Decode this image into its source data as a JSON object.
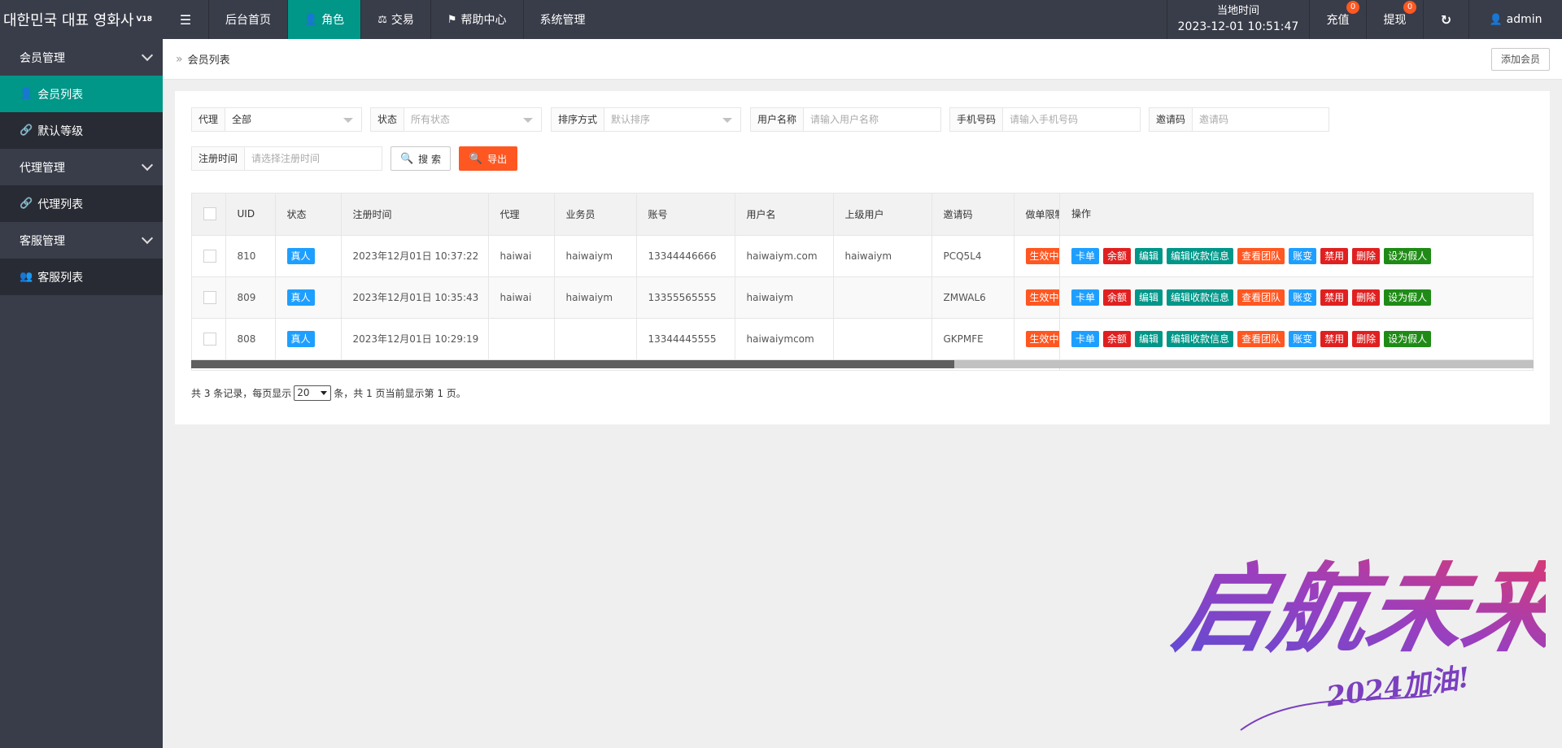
{
  "header": {
    "brand": "대한민국 대표 영화사",
    "version": "V18",
    "nav": [
      {
        "label": "后台首页",
        "icon": ""
      },
      {
        "label": "角色",
        "icon": "user-icon",
        "active": true
      },
      {
        "label": "交易",
        "icon": "scale-icon"
      },
      {
        "label": "帮助中心",
        "icon": "flag-icon"
      },
      {
        "label": "系统管理",
        "icon": ""
      }
    ],
    "clock_label": "当地时间",
    "clock_value": "2023-12-01 10:51:47",
    "recharge_label": "充值",
    "recharge_badge": "0",
    "withdraw_label": "提现",
    "withdraw_badge": "0",
    "user": "admin"
  },
  "sidebar": {
    "groups": [
      {
        "label": "会员管理",
        "items": [
          {
            "label": "会员列表",
            "active": true
          },
          {
            "label": "默认等级"
          }
        ]
      },
      {
        "label": "代理管理",
        "items": [
          {
            "label": "代理列表"
          }
        ]
      },
      {
        "label": "客服管理",
        "items": [
          {
            "label": "客服列表"
          }
        ]
      }
    ]
  },
  "breadcrumb": {
    "current": "会员列表",
    "add_button": "添加会员"
  },
  "filters": {
    "agent": {
      "label": "代理",
      "value": "全部"
    },
    "status": {
      "label": "状态",
      "placeholder": "所有状态"
    },
    "sort": {
      "label": "排序方式",
      "placeholder": "默认排序"
    },
    "username": {
      "label": "用户名称",
      "placeholder": "请输入用户名称"
    },
    "phone": {
      "label": "手机号码",
      "placeholder": "请输入手机号码"
    },
    "invite": {
      "label": "邀请码",
      "placeholder": "邀请码"
    },
    "regtime": {
      "label": "注册时间",
      "placeholder": "请选择注册时间"
    },
    "search_button": "搜 索",
    "export_button": "导出"
  },
  "table": {
    "headers": [
      "UID",
      "状态",
      "注册时间",
      "代理",
      "业务员",
      "账号",
      "用户名",
      "上级用户",
      "邀请码",
      "做单限制",
      "操作"
    ],
    "rows": [
      {
        "uid": "810",
        "status": "真人",
        "reg_time": "2023年12月01日 10:37:22",
        "agent": "haiwai",
        "salesman": "haiwaiym",
        "account": "13344446666",
        "username": "haiwaiym.com",
        "parent": "haiwaiym",
        "invite": "PCQ5L4",
        "limit": "生效中"
      },
      {
        "uid": "809",
        "status": "真人",
        "reg_time": "2023年12月01日 10:35:43",
        "agent": "haiwai",
        "salesman": "haiwaiym",
        "account": "13355565555",
        "username": "haiwaiym",
        "parent": "",
        "invite": "ZMWAL6",
        "limit": "生效中"
      },
      {
        "uid": "808",
        "status": "真人",
        "reg_time": "2023年12月01日 10:29:19",
        "agent": "",
        "salesman": "",
        "account": "13344445555",
        "username": "haiwaiymcom",
        "parent": "",
        "invite": "GKPMFE",
        "limit": "生效中"
      }
    ],
    "actions": [
      {
        "label": "卡单",
        "color": "#1e9fff"
      },
      {
        "label": "余额",
        "color": "#e02020"
      },
      {
        "label": "编辑",
        "color": "#009688"
      },
      {
        "label": "编辑收款信息",
        "color": "#009688"
      },
      {
        "label": "查看团队",
        "color": "#ff5722"
      },
      {
        "label": "账变",
        "color": "#1e9fff"
      },
      {
        "label": "禁用",
        "color": "#e02020"
      },
      {
        "label": "删除",
        "color": "#e02020"
      },
      {
        "label": "设为假人",
        "color": "#1f8b16"
      }
    ]
  },
  "pager": {
    "prefix": "共 3 条记录，每页显示",
    "page_size": "20",
    "suffix": "条，共 1 页当前显示第 1 页。"
  },
  "watermark": {
    "main": "启航未来",
    "sub": "2024加油!"
  },
  "colors": {
    "header": "#393d49",
    "accent": "#009688",
    "danger": "#ff5722"
  }
}
